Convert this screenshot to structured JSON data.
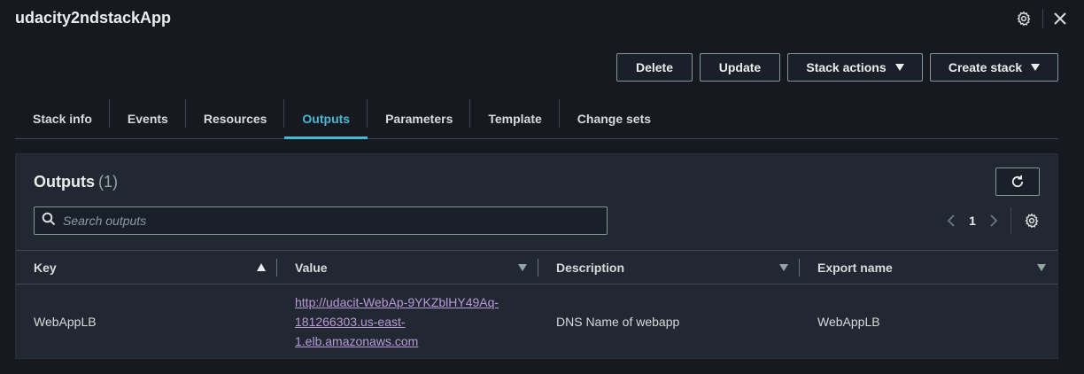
{
  "header": {
    "title": "udacity2ndstackApp",
    "icons": [
      "gear-icon",
      "close-icon"
    ]
  },
  "actions": {
    "delete": "Delete",
    "update": "Update",
    "stack_actions": "Stack actions",
    "create_stack": "Create stack"
  },
  "tabs": [
    {
      "label": "Stack info",
      "active": false
    },
    {
      "label": "Events",
      "active": false
    },
    {
      "label": "Resources",
      "active": false
    },
    {
      "label": "Outputs",
      "active": true
    },
    {
      "label": "Parameters",
      "active": false
    },
    {
      "label": "Template",
      "active": false
    },
    {
      "label": "Change sets",
      "active": false
    }
  ],
  "outputs": {
    "title": "Outputs",
    "count": "(1)",
    "search_placeholder": "Search outputs",
    "page_number": "1",
    "columns": [
      "Key",
      "Value",
      "Description",
      "Export name"
    ],
    "rows": [
      {
        "key": "WebAppLB",
        "value_lines": [
          "http://udacit-WebAp-9YKZblHY49Aq-",
          "181266303.us-east-",
          "1.elb.amazonaws.com"
        ],
        "description": "DNS Name of webapp",
        "export_name": "WebAppLB"
      }
    ]
  },
  "colors": {
    "background": "#16191f",
    "panel": "#222831",
    "accent": "#44b9d6",
    "link": "#b89ad9"
  }
}
